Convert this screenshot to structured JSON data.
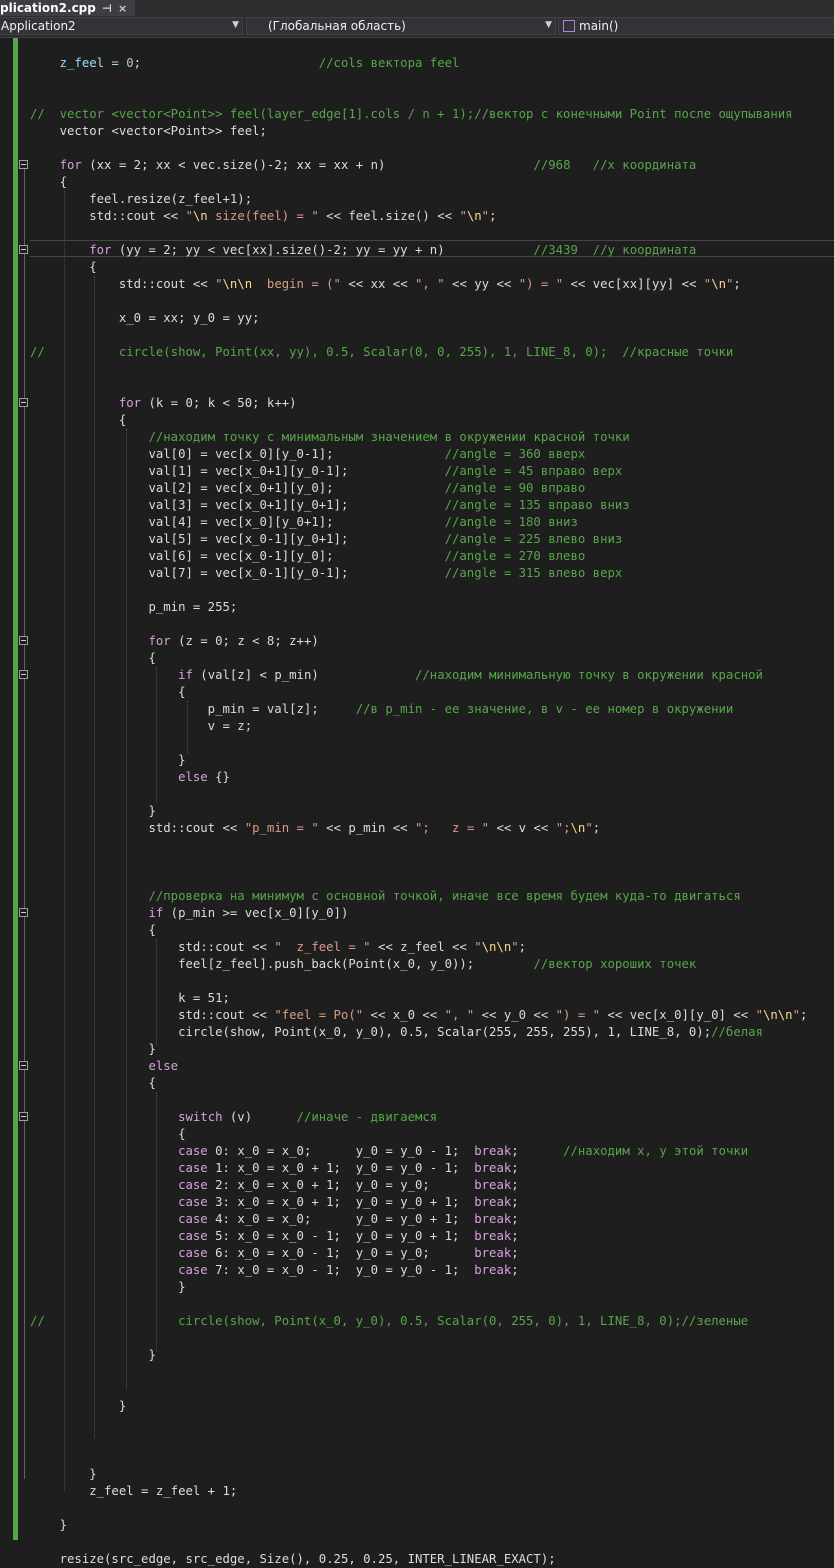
{
  "tab": {
    "title": "plication2.cpp",
    "pin": "⊣",
    "close": "×"
  },
  "navigation": {
    "project": "Application2",
    "scope": "(Глобальная область)",
    "member": "main()"
  },
  "code_lines": [
    {
      "t": []
    },
    {
      "t": [
        [
          "    z_feel = ",
          "var"
        ],
        [
          "0",
          "num"
        ],
        [
          ";                        ",
          ""
        ],
        [
          "//cols вектора feel",
          "cm"
        ]
      ]
    },
    {
      "t": []
    },
    {
      "t": []
    },
    {
      "t": [
        [
          "//  vector <vector<Point>> feel(layer_edge[1].cols / n + 1);//вектор с конечными Point после ощупывания",
          "cm"
        ]
      ]
    },
    {
      "t": [
        [
          "    vector <vector<Point>> feel;",
          ""
        ]
      ]
    },
    {
      "t": []
    },
    {
      "t": [
        [
          "    ",
          ""
        ],
        [
          "for",
          "ctl"
        ],
        [
          " (xx = 2; xx < vec.size()-2; xx = xx + n)                    ",
          ""
        ],
        [
          "//968   //x координата",
          "cm"
        ]
      ]
    },
    {
      "t": [
        [
          "    {",
          ""
        ]
      ]
    },
    {
      "t": [
        [
          "        feel.resize(z_feel+1);",
          ""
        ]
      ]
    },
    {
      "t": [
        [
          "        std::cout << ",
          ""
        ],
        [
          "\"",
          "str"
        ],
        [
          "\\n",
          "esc"
        ],
        [
          " size(feel) = \"",
          "str"
        ],
        [
          " << feel.size() << ",
          ""
        ],
        [
          "\"",
          "str"
        ],
        [
          "\\n",
          "esc"
        ],
        [
          "\"",
          "str"
        ],
        [
          ";",
          ""
        ]
      ]
    },
    {
      "t": []
    },
    {
      "t": [
        [
          "        ",
          ""
        ],
        [
          "for",
          "ctl"
        ],
        [
          " (yy = 2; yy < vec[xx].size()-2; yy = yy + n)            ",
          ""
        ],
        [
          "//3439  //y координата",
          "cm"
        ]
      ]
    },
    {
      "t": [
        [
          "        {",
          ""
        ]
      ]
    },
    {
      "t": [
        [
          "            std::cout << ",
          ""
        ],
        [
          "\"",
          "str"
        ],
        [
          "\\n\\n",
          "esc"
        ],
        [
          "  begin = (\"",
          "str"
        ],
        [
          " << xx << ",
          ""
        ],
        [
          "\", \"",
          "str"
        ],
        [
          " << yy << ",
          ""
        ],
        [
          "\") = \"",
          "str"
        ],
        [
          " << vec[xx][yy] << ",
          ""
        ],
        [
          "\"",
          "str"
        ],
        [
          "\\n",
          "esc"
        ],
        [
          "\"",
          "str"
        ],
        [
          ";",
          ""
        ]
      ]
    },
    {
      "t": []
    },
    {
      "t": [
        [
          "            x_0 = xx; y_0 = yy;",
          ""
        ]
      ]
    },
    {
      "t": []
    },
    {
      "t": [
        [
          "//          circle(show, Point(xx, yy), 0.5, Scalar(0, 0, 255), 1, LINE_8, 0);  //красные точки",
          "cm"
        ]
      ]
    },
    {
      "t": []
    },
    {
      "t": []
    },
    {
      "t": [
        [
          "            ",
          ""
        ],
        [
          "for",
          "ctl"
        ],
        [
          " (k = 0; k < 50; k++)",
          ""
        ]
      ]
    },
    {
      "t": [
        [
          "            {",
          ""
        ]
      ]
    },
    {
      "t": [
        [
          "                ",
          ""
        ],
        [
          "//находим точку с минимальным значением в окружении красной точки",
          "cm"
        ]
      ]
    },
    {
      "t": [
        [
          "                val[0] = vec[x_0][y_0-1];               ",
          ""
        ],
        [
          "//angle = 360 вверх",
          "cm"
        ]
      ]
    },
    {
      "t": [
        [
          "                val[1] = vec[x_0+1][y_0-1];             ",
          ""
        ],
        [
          "//angle = 45 вправо верх",
          "cm"
        ]
      ]
    },
    {
      "t": [
        [
          "                val[2] = vec[x_0+1][y_0];               ",
          ""
        ],
        [
          "//angle = 90 вправо",
          "cm"
        ]
      ]
    },
    {
      "t": [
        [
          "                val[3] = vec[x_0+1][y_0+1];             ",
          ""
        ],
        [
          "//angle = 135 вправо вниз",
          "cm"
        ]
      ]
    },
    {
      "t": [
        [
          "                val[4] = vec[x_0][y_0+1];               ",
          ""
        ],
        [
          "//angle = 180 вниз",
          "cm"
        ]
      ]
    },
    {
      "t": [
        [
          "                val[5] = vec[x_0-1][y_0+1];             ",
          ""
        ],
        [
          "//angle = 225 влево вниз",
          "cm"
        ]
      ]
    },
    {
      "t": [
        [
          "                val[6] = vec[x_0-1][y_0];               ",
          ""
        ],
        [
          "//angle = 270 влево",
          "cm"
        ]
      ]
    },
    {
      "t": [
        [
          "                val[7] = vec[x_0-1][y_0-1];             ",
          ""
        ],
        [
          "//angle = 315 влево верх",
          "cm"
        ]
      ]
    },
    {
      "t": []
    },
    {
      "t": [
        [
          "                p_min = 255;",
          ""
        ]
      ]
    },
    {
      "t": []
    },
    {
      "t": [
        [
          "                ",
          ""
        ],
        [
          "for",
          "ctl"
        ],
        [
          " (z = 0; z < 8; z++)",
          ""
        ]
      ]
    },
    {
      "t": [
        [
          "                {",
          ""
        ]
      ]
    },
    {
      "t": [
        [
          "                    ",
          ""
        ],
        [
          "if",
          "ctl"
        ],
        [
          " (val[z] < p_min)             ",
          ""
        ],
        [
          "//находим минимальную точку в окружении красной",
          "cm"
        ]
      ]
    },
    {
      "t": [
        [
          "                    {",
          ""
        ]
      ]
    },
    {
      "t": [
        [
          "                        p_min = val[z];     ",
          ""
        ],
        [
          "//в p_min - ее значение, в v - ее номер в окружении",
          "cm"
        ]
      ]
    },
    {
      "t": [
        [
          "                        v = z;",
          ""
        ]
      ]
    },
    {
      "t": []
    },
    {
      "t": [
        [
          "                    }",
          ""
        ]
      ]
    },
    {
      "t": [
        [
          "                    ",
          ""
        ],
        [
          "else",
          "ctl"
        ],
        [
          " {}",
          ""
        ]
      ]
    },
    {
      "t": []
    },
    {
      "t": [
        [
          "                }",
          ""
        ]
      ]
    },
    {
      "t": [
        [
          "                std::cout << ",
          ""
        ],
        [
          "\"p_min = \"",
          "str"
        ],
        [
          " << p_min << ",
          ""
        ],
        [
          "\";   z = \"",
          "str"
        ],
        [
          " << v << ",
          ""
        ],
        [
          "\";",
          "str"
        ],
        [
          "\\n",
          "esc"
        ],
        [
          "\"",
          "str"
        ],
        [
          ";",
          ""
        ]
      ]
    },
    {
      "t": []
    },
    {
      "t": []
    },
    {
      "t": []
    },
    {
      "t": [
        [
          "                ",
          ""
        ],
        [
          "//проверка на минимум с основной точкой, иначе все время будем куда-то двигаться",
          "cm"
        ]
      ]
    },
    {
      "t": [
        [
          "                ",
          ""
        ],
        [
          "if",
          "ctl"
        ],
        [
          " (p_min >= vec[x_0][y_0])",
          ""
        ]
      ]
    },
    {
      "t": [
        [
          "                {",
          ""
        ]
      ]
    },
    {
      "t": [
        [
          "                    std::cout << ",
          ""
        ],
        [
          "\"  z_feel = \"",
          "str"
        ],
        [
          " << z_feel << ",
          ""
        ],
        [
          "\"",
          "str"
        ],
        [
          "\\n\\n",
          "esc"
        ],
        [
          "\"",
          "str"
        ],
        [
          ";",
          ""
        ]
      ]
    },
    {
      "t": [
        [
          "                    feel[z_feel].push_back(Point(x_0, y_0));        ",
          ""
        ],
        [
          "//вектор хороших точек",
          "cm"
        ]
      ]
    },
    {
      "t": []
    },
    {
      "t": [
        [
          "                    k = 51;",
          ""
        ]
      ]
    },
    {
      "t": [
        [
          "                    std::cout << ",
          ""
        ],
        [
          "\"feel = Po(\"",
          "str"
        ],
        [
          " << x_0 << ",
          ""
        ],
        [
          "\", \"",
          "str"
        ],
        [
          " << y_0 << ",
          ""
        ],
        [
          "\") = \"",
          "str"
        ],
        [
          " << vec[x_0][y_0] << ",
          ""
        ],
        [
          "\"",
          "str"
        ],
        [
          "\\n\\n",
          "esc"
        ],
        [
          "\"",
          "str"
        ],
        [
          ";",
          ""
        ]
      ]
    },
    {
      "t": [
        [
          "                    circle(show, Point(x_0, y_0), 0.5, Scalar(255, 255, 255), 1, LINE_8, 0);",
          ""
        ],
        [
          "//белая",
          "cm"
        ]
      ]
    },
    {
      "t": [
        [
          "                }",
          ""
        ]
      ]
    },
    {
      "t": [
        [
          "                ",
          ""
        ],
        [
          "else",
          "ctl"
        ]
      ]
    },
    {
      "t": [
        [
          "                {",
          ""
        ]
      ]
    },
    {
      "t": []
    },
    {
      "t": [
        [
          "                    ",
          ""
        ],
        [
          "switch",
          "ctl"
        ],
        [
          " (v)      ",
          ""
        ],
        [
          "//иначе - двигаемся",
          "cm"
        ]
      ]
    },
    {
      "t": [
        [
          "                    {",
          ""
        ]
      ]
    },
    {
      "t": [
        [
          "                    ",
          ""
        ],
        [
          "case",
          "ctl"
        ],
        [
          " 0: x_0 = x_0;      y_0 = y_0 - 1;  ",
          ""
        ],
        [
          "break",
          "ctl"
        ],
        [
          ";      ",
          ""
        ],
        [
          "//находим x, y этой точки",
          "cm"
        ]
      ]
    },
    {
      "t": [
        [
          "                    ",
          ""
        ],
        [
          "case",
          "ctl"
        ],
        [
          " 1: x_0 = x_0 + 1;  y_0 = y_0 - 1;  ",
          ""
        ],
        [
          "break",
          "ctl"
        ],
        [
          ";",
          ""
        ]
      ]
    },
    {
      "t": [
        [
          "                    ",
          ""
        ],
        [
          "case",
          "ctl"
        ],
        [
          " 2: x_0 = x_0 + 1;  y_0 = y_0;      ",
          ""
        ],
        [
          "break",
          "ctl"
        ],
        [
          ";",
          ""
        ]
      ]
    },
    {
      "t": [
        [
          "                    ",
          ""
        ],
        [
          "case",
          "ctl"
        ],
        [
          " 3: x_0 = x_0 + 1;  y_0 = y_0 + 1;  ",
          ""
        ],
        [
          "break",
          "ctl"
        ],
        [
          ";",
          ""
        ]
      ]
    },
    {
      "t": [
        [
          "                    ",
          ""
        ],
        [
          "case",
          "ctl"
        ],
        [
          " 4: x_0 = x_0;      y_0 = y_0 + 1;  ",
          ""
        ],
        [
          "break",
          "ctl"
        ],
        [
          ";",
          ""
        ]
      ]
    },
    {
      "t": [
        [
          "                    ",
          ""
        ],
        [
          "case",
          "ctl"
        ],
        [
          " 5: x_0 = x_0 - 1;  y_0 = y_0 + 1;  ",
          ""
        ],
        [
          "break",
          "ctl"
        ],
        [
          ";",
          ""
        ]
      ]
    },
    {
      "t": [
        [
          "                    ",
          ""
        ],
        [
          "case",
          "ctl"
        ],
        [
          " 6: x_0 = x_0 - 1;  y_0 = y_0;      ",
          ""
        ],
        [
          "break",
          "ctl"
        ],
        [
          ";",
          ""
        ]
      ]
    },
    {
      "t": [
        [
          "                    ",
          ""
        ],
        [
          "case",
          "ctl"
        ],
        [
          " 7: x_0 = x_0 - 1;  y_0 = y_0 - 1;  ",
          ""
        ],
        [
          "break",
          "ctl"
        ],
        [
          ";",
          ""
        ]
      ]
    },
    {
      "t": [
        [
          "                    }",
          ""
        ]
      ]
    },
    {
      "t": []
    },
    {
      "t": [
        [
          "//                  circle(show, Point(x_0, y_0), 0.5, Scalar(0, 255, 0), 1, LINE_8, 0);//зеленые",
          "cm"
        ]
      ]
    },
    {
      "t": []
    },
    {
      "t": [
        [
          "                }",
          ""
        ]
      ]
    },
    {
      "t": []
    },
    {
      "t": []
    },
    {
      "t": [
        [
          "            }",
          ""
        ]
      ]
    },
    {
      "t": []
    },
    {
      "t": []
    },
    {
      "t": []
    },
    {
      "t": [
        [
          "        }",
          ""
        ]
      ]
    },
    {
      "t": [
        [
          "        z_feel = z_feel + 1;",
          ""
        ]
      ]
    },
    {
      "t": []
    },
    {
      "t": [
        [
          "    }",
          ""
        ]
      ]
    },
    {
      "t": []
    },
    {
      "t": [
        [
          "    resize(src_edge, src_edge, Size(), 0.25, 0.25, INTER_LINEAR_EXACT);",
          ""
        ]
      ]
    }
  ]
}
